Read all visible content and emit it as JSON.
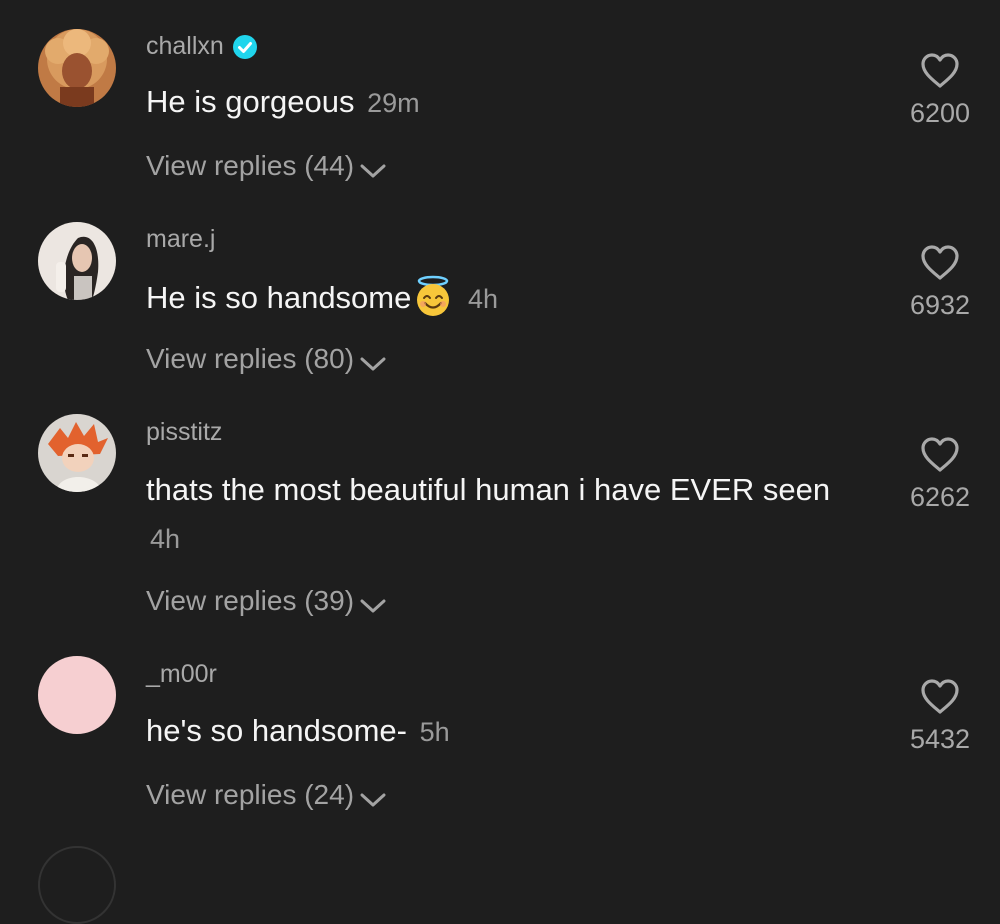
{
  "comments": [
    {
      "username": "challxn",
      "verified": true,
      "text": "He is gorgeous",
      "time": "29m",
      "likes": "6200",
      "replies_label": "View replies (44)",
      "avatar_color": "#b86a3c"
    },
    {
      "username": "mare.j",
      "verified": false,
      "text": "He is so handsome",
      "emoji": "smiling-face-with-halo",
      "time": "4h",
      "likes": "6932",
      "replies_label": "View replies (80)",
      "avatar_color": "#e9e3de"
    },
    {
      "username": "pisstitz",
      "verified": false,
      "text": "thats the most beautiful human i have EVER seen",
      "time": "4h",
      "likes": "6262",
      "replies_label": "View replies (39)",
      "avatar_color": "#d8d4cf"
    },
    {
      "username": "_m00r",
      "verified": false,
      "text": "he's so handsome-",
      "time": "5h",
      "likes": "5432",
      "replies_label": "View replies (24)",
      "avatar_color": "#f6cfd1"
    }
  ],
  "colors": {
    "background": "#1e1e1e",
    "username": "#a9a9a9",
    "text": "#f5f5f5",
    "verified": "#20d5ec"
  },
  "icons": {
    "like": "heart-outline-icon",
    "expand": "chevron-down-icon",
    "verified": "verified-badge-icon"
  }
}
